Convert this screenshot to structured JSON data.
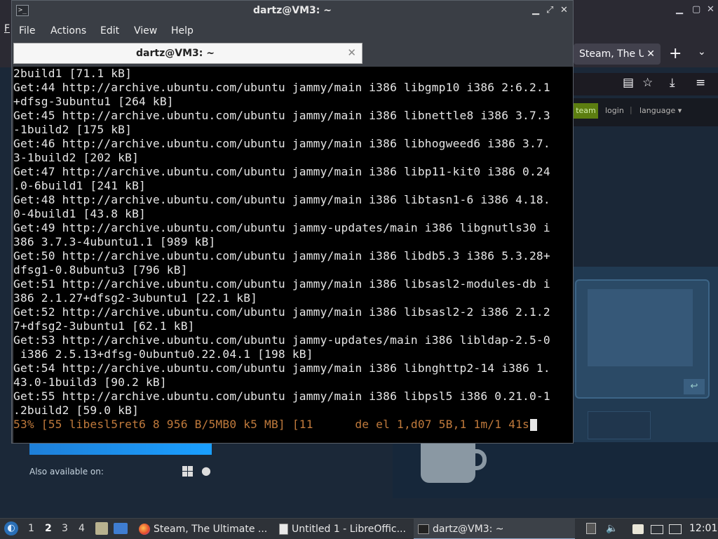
{
  "terminal": {
    "window_title": "dartz@VM3: ~",
    "title_icon_glyph": ">_",
    "menu": [
      "File",
      "Actions",
      "Edit",
      "View",
      "Help"
    ],
    "tab_label": "dartz@VM3: ~",
    "lines": [
      "2build1 [71.1 kB]",
      "Get:44 http://archive.ubuntu.com/ubuntu jammy/main i386 libgmp10 i386 2:6.2.1",
      "+dfsg-3ubuntu1 [264 kB]",
      "Get:45 http://archive.ubuntu.com/ubuntu jammy/main i386 libnettle8 i386 3.7.3",
      "-1build2 [175 kB]",
      "Get:46 http://archive.ubuntu.com/ubuntu jammy/main i386 libhogweed6 i386 3.7.",
      "3-1build2 [202 kB]",
      "Get:47 http://archive.ubuntu.com/ubuntu jammy/main i386 libp11-kit0 i386 0.24",
      ".0-6build1 [241 kB]",
      "Get:48 http://archive.ubuntu.com/ubuntu jammy/main i386 libtasn1-6 i386 4.18.",
      "0-4build1 [43.8 kB]",
      "Get:49 http://archive.ubuntu.com/ubuntu jammy-updates/main i386 libgnutls30 i",
      "386 3.7.3-4ubuntu1.1 [989 kB]",
      "Get:50 http://archive.ubuntu.com/ubuntu jammy/main i386 libdb5.3 i386 5.3.28+",
      "dfsg1-0.8ubuntu3 [796 kB]",
      "Get:51 http://archive.ubuntu.com/ubuntu jammy/main i386 libsasl2-modules-db i",
      "386 2.1.27+dfsg2-3ubuntu1 [22.1 kB]",
      "Get:52 http://archive.ubuntu.com/ubuntu jammy/main i386 libsasl2-2 i386 2.1.2",
      "7+dfsg2-3ubuntu1 [62.1 kB]",
      "Get:53 http://archive.ubuntu.com/ubuntu jammy-updates/main i386 libldap-2.5-0",
      " i386 2.5.13+dfsg-0ubuntu0.22.04.1 [198 kB]",
      "Get:54 http://archive.ubuntu.com/ubuntu jammy/main i386 libnghttp2-14 i386 1.",
      "43.0-1build3 [90.2 kB]",
      "Get:55 http://archive.ubuntu.com/ubuntu jammy/main i386 libpsl5 i386 0.21.0-1",
      ".2build2 [59.0 kB]"
    ],
    "progress_line": "53% [55 libesl5ret6 8 956 B/5MB0 k5 MB] [11      de el 1,d07 5B,1 1m/1 41s"
  },
  "browser": {
    "menu_first_letter": "F",
    "tab_title": "Steam, The U",
    "steam_nav": {
      "install_label": "team",
      "login_label": "login",
      "separator": "|",
      "language_label": "language ▾"
    },
    "also_available": "Also available on:",
    "enter_glyph": "↩"
  },
  "taskbar": {
    "workspaces": [
      "1",
      "2",
      "3",
      "4"
    ],
    "active_workspace": "2",
    "tasks": [
      {
        "label": "Steam, The Ultimate ..."
      },
      {
        "label": "Untitled 1 - LibreOffic..."
      },
      {
        "label": "dartz@VM3: ~"
      }
    ],
    "clock": "12:01"
  },
  "colors": {
    "terminal_bg": "#000000",
    "terminal_fg": "#e6e6e6",
    "progress_fg": "#c07a3c",
    "titlebar": "#3a3e45",
    "steam_bg": "#1b2838",
    "steam_green": "#5c7e10",
    "steam_blue": "#1a9fff"
  }
}
